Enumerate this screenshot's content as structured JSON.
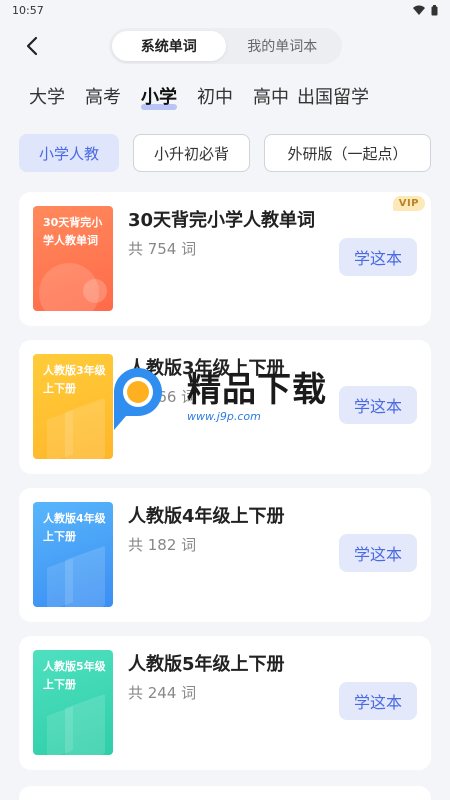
{
  "status": {
    "time": "10:57"
  },
  "header": {
    "tabs": [
      {
        "label": "系统单词",
        "active": true
      },
      {
        "label": "我的单词本",
        "active": false
      }
    ]
  },
  "categories": [
    {
      "label": "大学"
    },
    {
      "label": "高考"
    },
    {
      "label": "小学",
      "active": true
    },
    {
      "label": "初中"
    },
    {
      "label": "高中"
    },
    {
      "label": "出国留学"
    }
  ],
  "filters": [
    {
      "label": "小学人教",
      "active": true
    },
    {
      "label": "小升初必背"
    },
    {
      "label": "外研版（一起点）"
    }
  ],
  "books": [
    {
      "cover_text": "30天背完小学人教单词",
      "title": "30天背完小学人教单词",
      "count": "共 754 词",
      "button": "学这本",
      "badge": "VIP",
      "color": "orange"
    },
    {
      "cover_text": "人教版3年级上下册",
      "title": "人教版3年级上下册",
      "count": "共 166 词",
      "button": "学这本",
      "color": "yellow"
    },
    {
      "cover_text": "人教版4年级上下册",
      "title": "人教版4年级上下册",
      "count": "共 182 词",
      "button": "学这本",
      "color": "blue"
    },
    {
      "cover_text": "人教版5年级上下册",
      "title": "人教版5年级上下册",
      "count": "共 244 词",
      "button": "学这本",
      "color": "green"
    }
  ],
  "watermark": {
    "text": "精品下载",
    "url": "www.j9p.com"
  }
}
